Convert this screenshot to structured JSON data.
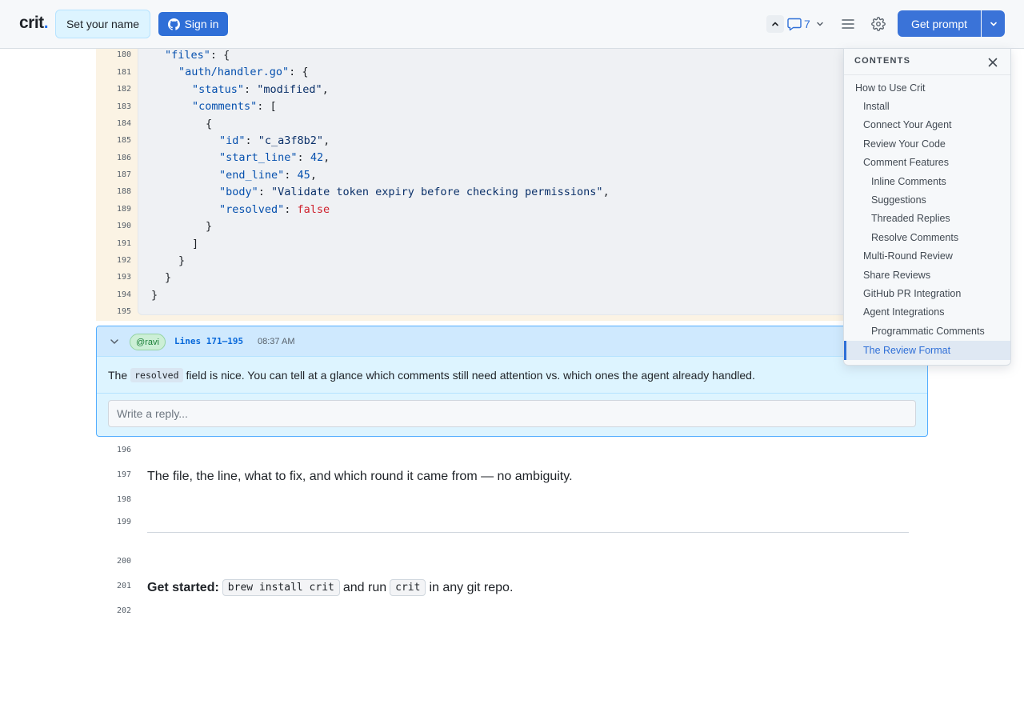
{
  "header": {
    "logo_text": "crit",
    "logo_dot": ".",
    "set_name_label": "Set your name",
    "sign_in_label": "Sign in",
    "comment_count": "7",
    "get_prompt_label": "Get prompt"
  },
  "code": {
    "lines": [
      {
        "n": "180",
        "html_key": "l180"
      },
      {
        "n": "181"
      },
      {
        "n": "182"
      },
      {
        "n": "183"
      },
      {
        "n": "184"
      },
      {
        "n": "185"
      },
      {
        "n": "186"
      },
      {
        "n": "187"
      },
      {
        "n": "188"
      },
      {
        "n": "189"
      },
      {
        "n": "190"
      },
      {
        "n": "191"
      },
      {
        "n": "192"
      },
      {
        "n": "193"
      },
      {
        "n": "194"
      },
      {
        "n": "195"
      }
    ],
    "text": {
      "files_key": "\"files\"",
      "handler_key": "\"auth/handler.go\"",
      "status_key": "\"status\"",
      "status_val": "\"modified\"",
      "comments_key": "\"comments\"",
      "id_key": "\"id\"",
      "id_val": "\"c_a3f8b2\"",
      "start_key": "\"start_line\"",
      "start_val": "42",
      "end_key": "\"end_line\"",
      "end_val": "45",
      "body_key": "\"body\"",
      "body_val": "\"Validate token expiry before checking permissions\"",
      "resolved_key": "\"resolved\"",
      "resolved_val": "false"
    }
  },
  "comment": {
    "user": "@ravi",
    "lines": "Lines 171–195",
    "time": "08:37 AM",
    "body_before": "The",
    "body_code": "resolved",
    "body_after": "field is nice. You can tell at a glance which comments still need attention vs. which ones the agent already handled.",
    "reply_placeholder": "Write a reply..."
  },
  "doc": {
    "ln196": "196",
    "ln197": "197",
    "ln198": "198",
    "ln199": "199",
    "ln200": "200",
    "ln201": "201",
    "ln202": "202",
    "para197": "The file, the line, what to fix, and which round it came from — no ambiguity.",
    "get_started_bold": "Get started:",
    "cmd_install": "brew install crit",
    "and_run": "and run",
    "cmd_crit": "crit",
    "in_repo": "in any git repo."
  },
  "toc": {
    "title": "CONTENTS",
    "items": [
      {
        "label": "How to Use Crit",
        "level": 0
      },
      {
        "label": "Install",
        "level": 1
      },
      {
        "label": "Connect Your Agent",
        "level": 1
      },
      {
        "label": "Review Your Code",
        "level": 1
      },
      {
        "label": "Comment Features",
        "level": 1
      },
      {
        "label": "Inline Comments",
        "level": 2
      },
      {
        "label": "Suggestions",
        "level": 2
      },
      {
        "label": "Threaded Replies",
        "level": 2
      },
      {
        "label": "Resolve Comments",
        "level": 2
      },
      {
        "label": "Multi-Round Review",
        "level": 1
      },
      {
        "label": "Share Reviews",
        "level": 1
      },
      {
        "label": "GitHub PR Integration",
        "level": 1
      },
      {
        "label": "Agent Integrations",
        "level": 1
      },
      {
        "label": "Programmatic Comments",
        "level": 2
      },
      {
        "label": "The Review Format",
        "level": 1,
        "active": true
      }
    ]
  }
}
